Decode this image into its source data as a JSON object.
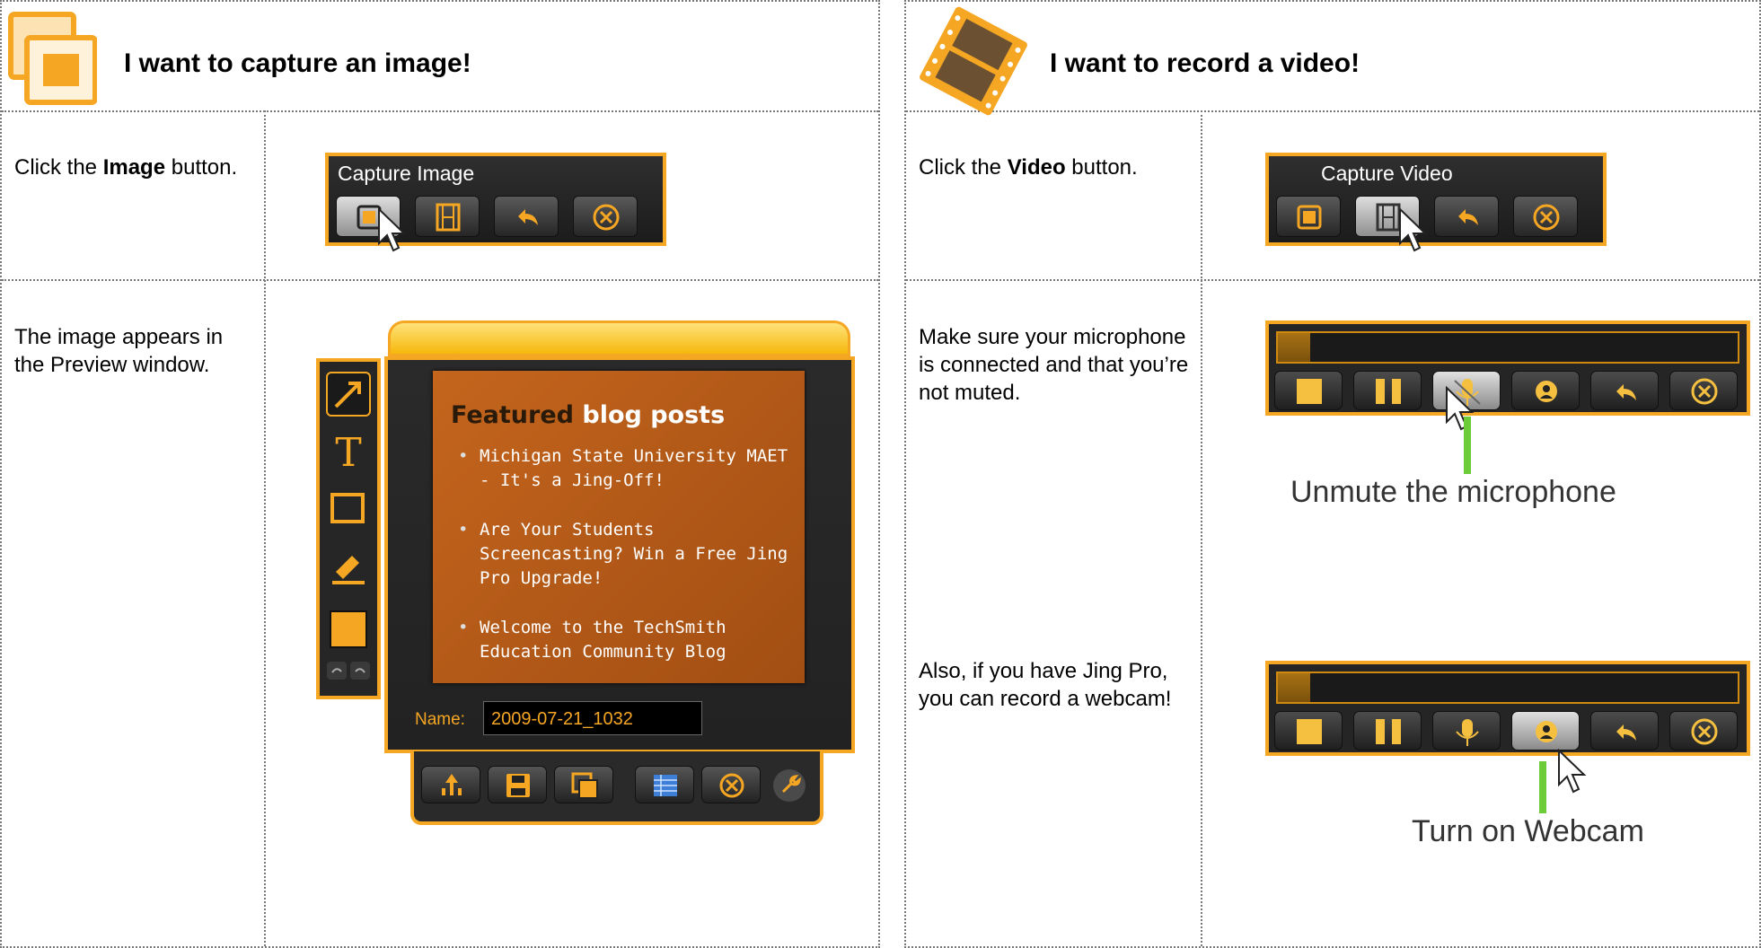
{
  "image_section": {
    "title": "I want to capture an image!",
    "step1": {
      "text_before": "Click the ",
      "bold": "Image",
      "text_after": " button."
    },
    "step2": {
      "text": "The image appears in the Preview window."
    },
    "capture_bar": {
      "title": "Capture Image"
    },
    "preview": {
      "heading_dark": "Featured ",
      "heading_light": "blog posts",
      "posts": [
        "Michigan State University MAET - It's a Jing-Off!",
        "Are Your Students Screencasting? Win a Free Jing Pro Upgrade!",
        "Welcome to the TechSmith Education Community Blog"
      ],
      "name_label": "Name:",
      "name_value": "2009-07-21_1032"
    }
  },
  "video_section": {
    "title": "I want to record a video!",
    "step1": {
      "text_before": "Click the ",
      "bold": "Video",
      "text_after": " button."
    },
    "capture_bar": {
      "title": "Capture Video"
    },
    "step2": {
      "text": "Make sure your microphone is connected and that you’re not muted."
    },
    "callout_mic": "Unmute the microphone",
    "step3": {
      "text": "Also, if you have Jing Pro, you can record a webcam!"
    },
    "callout_webcam": "Turn on Webcam",
    "recording_progress": 0.07
  },
  "colors": {
    "accent": "#f5a623",
    "green": "#6ccc3a",
    "toolbar": "#252525"
  }
}
